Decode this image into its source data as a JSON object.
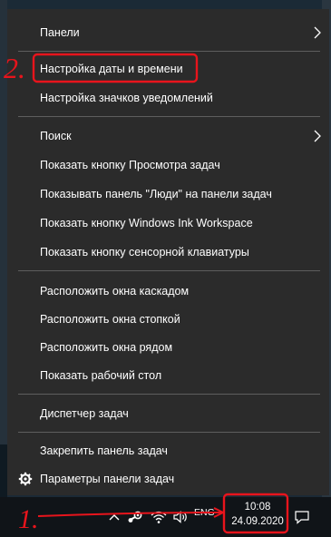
{
  "context_menu": {
    "items": [
      {
        "label": "Панели",
        "submenu": true
      },
      {
        "label": "Настройка даты и времени"
      },
      {
        "label": "Настройка значков уведомлений"
      },
      {
        "label": "Поиск",
        "submenu": true
      },
      {
        "label": "Показать кнопку Просмотра задач"
      },
      {
        "label": "Показывать панель \"Люди\" на панели задач"
      },
      {
        "label": "Показать кнопку Windows Ink Workspace"
      },
      {
        "label": "Показать кнопку сенсорной клавиатуры"
      },
      {
        "label": "Расположить окна каскадом"
      },
      {
        "label": "Расположить окна стопкой"
      },
      {
        "label": "Расположить окна рядом"
      },
      {
        "label": "Показать рабочий стол"
      },
      {
        "label": "Диспетчер задач"
      },
      {
        "label": "Закрепить панель задач"
      },
      {
        "label": "Параметры панели задач",
        "icon": "gear-icon"
      }
    ]
  },
  "taskbar": {
    "tray_icons": [
      "chevron-up-icon",
      "steam-icon",
      "wifi-icon",
      "volume-icon"
    ],
    "language": "ENG",
    "time": "10:08",
    "date": "24.09.2020",
    "notification_icon": "action-center-icon"
  },
  "annotations": {
    "marker_1": "1.",
    "marker_2": "2.",
    "color": "#e8141c"
  }
}
